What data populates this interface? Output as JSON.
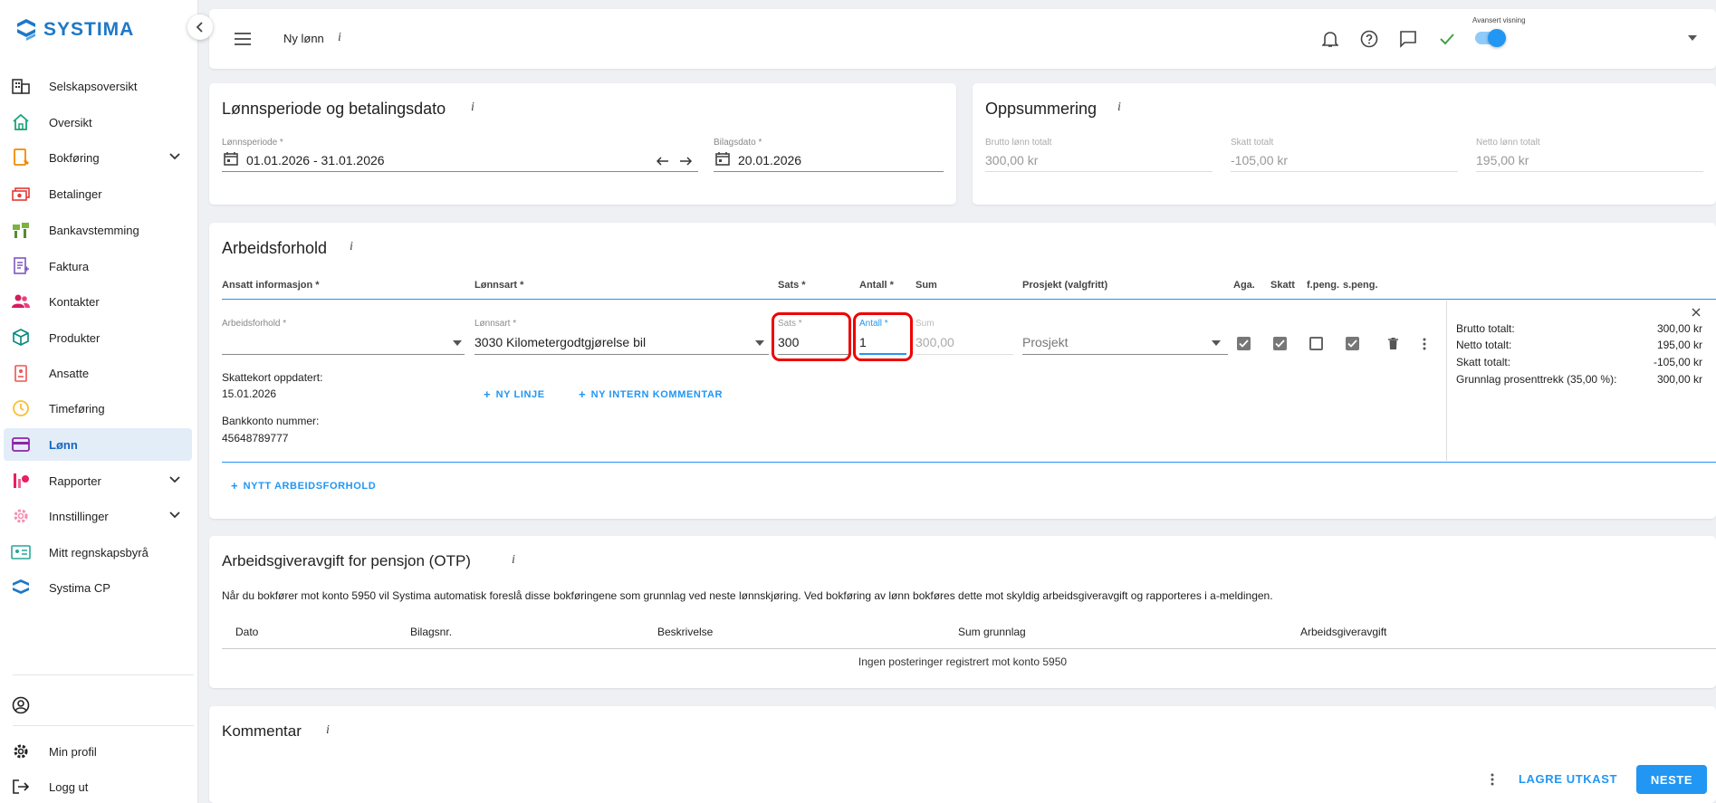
{
  "app": {
    "brand": "SYSTIMA",
    "accent": "#2196f3"
  },
  "sidebar": {
    "items": [
      {
        "label": "Selskapsoversikt",
        "icon": "building-icon"
      },
      {
        "label": "Oversikt",
        "icon": "home-icon"
      },
      {
        "label": "Bokføring",
        "icon": "ledger-icon",
        "expandable": true
      },
      {
        "label": "Betalinger",
        "icon": "payment-icon"
      },
      {
        "label": "Bankavstemming",
        "icon": "bank-reconcile-icon"
      },
      {
        "label": "Faktura",
        "icon": "invoice-icon"
      },
      {
        "label": "Kontakter",
        "icon": "contacts-icon"
      },
      {
        "label": "Produkter",
        "icon": "product-box-icon"
      },
      {
        "label": "Ansatte",
        "icon": "employee-badge-icon"
      },
      {
        "label": "Timeføring",
        "icon": "clock-icon"
      },
      {
        "label": "Lønn",
        "icon": "salary-card-icon",
        "active": true
      },
      {
        "label": "Rapporter",
        "icon": "report-chart-icon",
        "expandable": true
      },
      {
        "label": "Innstillinger",
        "icon": "settings-gear-icon",
        "expandable": true
      },
      {
        "label": "Mitt regnskapsbyrå",
        "icon": "accountant-card-icon"
      },
      {
        "label": "Systima CP",
        "icon": "systima-logo-icon"
      }
    ],
    "bottom": [
      {
        "label": "",
        "icon": "user-circle-icon"
      },
      {
        "label": "Min profil",
        "icon": "gear-icon"
      },
      {
        "label": "Logg ut",
        "icon": "logout-icon"
      }
    ]
  },
  "topbar": {
    "title": "Ny lønn",
    "info": "i",
    "advanced_label": "Avansert visning",
    "advanced_on": true
  },
  "period_card": {
    "title": "Lønnsperiode og betalingsdato",
    "info": "i",
    "period_label": "Lønnsperiode *",
    "period_value": "01.01.2026 - 31.01.2026",
    "date_label": "Bilagsdato *",
    "date_value": "20.01.2026"
  },
  "summary_card": {
    "title": "Oppsummering",
    "info": "i",
    "brutto_label": "Brutto lønn totalt",
    "brutto_value": "300,00 kr",
    "skatt_label": "Skatt totalt",
    "skatt_value": "-105,00 kr",
    "netto_label": "Netto lønn totalt",
    "netto_value": "195,00 kr"
  },
  "employment": {
    "title": "Arbeidsforhold",
    "info": "i",
    "headers": [
      "Ansatt informasjon *",
      "Lønnsart *",
      "Sats *",
      "Antall *",
      "Sum",
      "Prosjekt (valgfritt)",
      "Aga.",
      "Skatt",
      "f.peng.",
      "s.peng."
    ],
    "row": {
      "arbeidsforhold_label": "Arbeidsforhold *",
      "arbeidsforhold_value": "",
      "lonnsart_label": "Lønnsart *",
      "lonnsart_value": "3030 Kilometergodtgjørelse bil",
      "sats_label": "Sats *",
      "sats_value": "300",
      "antall_label": "Antall *",
      "antall_value": "1",
      "sum_label": "Sum",
      "sum_value": "300,00",
      "prosjekt_placeholder": "Prosjekt"
    },
    "skattekort_label": "Skattekort oppdatert:",
    "skattekort_date": "15.01.2026",
    "bankkonto_label": "Bankkonto nummer:",
    "bankkonto_value": "45648789777",
    "new_line": "NY LINJE",
    "new_comment": "NY INTERN KOMMENTAR",
    "new_employment": "NYTT ARBEIDSFORHOLD",
    "totals": [
      {
        "label": "Brutto totalt:",
        "value": "300,00 kr"
      },
      {
        "label": "Netto totalt:",
        "value": "195,00 kr"
      },
      {
        "label": "Skatt totalt:",
        "value": "-105,00 kr"
      },
      {
        "label": "Grunnlag prosenttrekk (35,00 %):",
        "value": "300,00 kr"
      }
    ]
  },
  "otp": {
    "title": "Arbeidsgiveravgift for pensjon (OTP)",
    "info": "i",
    "description": "Når du bokfører mot konto 5950 vil Systima automatisk foreslå disse bokføringene som grunnlag ved neste lønnskjøring. Ved bokføring av lønn bokføres dette mot skyldig arbeidsgiveravgift og rapporteres i a-meldingen.",
    "columns": [
      "Dato",
      "Bilagsnr.",
      "Beskrivelse",
      "Sum grunnlag",
      "Arbeidsgiveravgift"
    ],
    "empty": "Ingen posteringer registrert mot konto 5950"
  },
  "comment": {
    "title": "Kommentar",
    "info": "i"
  },
  "footer": {
    "save_draft": "LAGRE UTKAST",
    "next": "NESTE"
  }
}
